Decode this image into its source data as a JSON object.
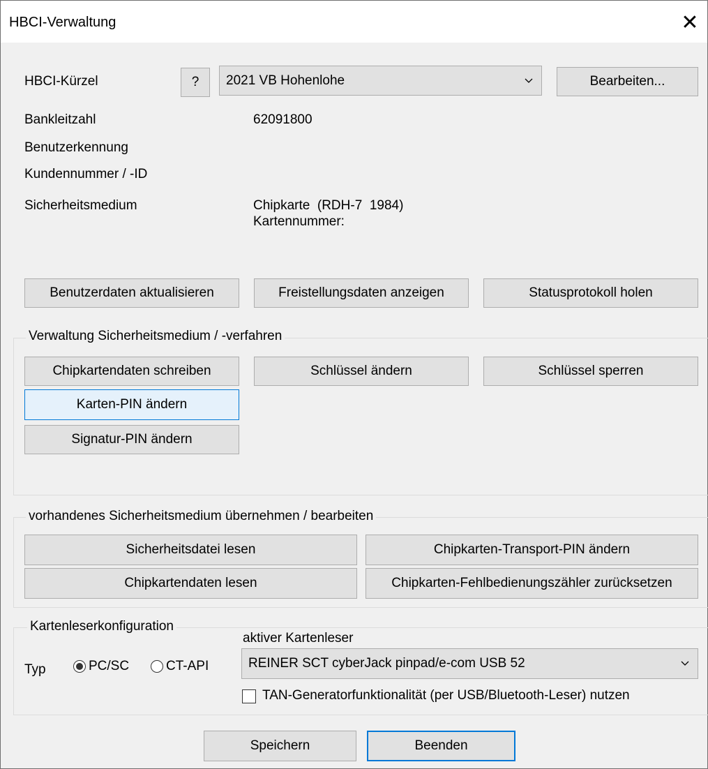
{
  "window": {
    "title": "HBCI-Verwaltung",
    "close_symbol": "✕"
  },
  "bank": {
    "hbci_label": "HBCI-Kürzel",
    "help_label": "?",
    "hbci_value": "2021 VB Hohenlohe",
    "edit_label": "Bearbeiten...",
    "blz_label": "Bankleitzahl",
    "blz_value": "62091800",
    "user_label": "Benutzerkennung",
    "customer_label": "Kundennummer / -ID",
    "medium_label": "Sicherheitsmedium",
    "medium_value": "Chipkarte  (RDH-7  1984)",
    "card_number_label": "Kartennummer:",
    "buttons": {
      "update_user": "Benutzerdaten aktualisieren",
      "show_release": "Freistellungsdaten anzeigen",
      "fetch_status": "Statusprotokoll holen"
    }
  },
  "security_admin": {
    "title": "Verwaltung Sicherheitsmedium / -verfahren",
    "buttons": {
      "write_chip": "Chipkartendaten schreiben",
      "change_key": "Schlüssel ändern",
      "lock_key": "Schlüssel sperren",
      "change_card_pin": "Karten-PIN ändern",
      "change_sig_pin": "Signatur-PIN ändern"
    }
  },
  "existing_medium": {
    "title": "vorhandenes Sicherheitsmedium übernehmen / bearbeiten",
    "buttons": {
      "read_file": "Sicherheitsdatei lesen",
      "change_transport_pin": "Chipkarten-Transport-PIN ändern",
      "read_chip": "Chipkartendaten lesen",
      "reset_counter": "Chipkarten-Fehlbedienungszähler zurücksetzen"
    }
  },
  "reader_config": {
    "title": "Kartenleserkonfiguration",
    "active_reader_label": "aktiver Kartenleser",
    "type_label": "Typ",
    "radio_pcsc": "PC/SC",
    "radio_ctapi": "CT-API",
    "selected_type": "PC/SC",
    "reader_value": "REINER SCT cyberJack pinpad/e-com USB 52",
    "tan_checkbox_label": "TAN-Generatorfunktionalität (per USB/Bluetooth-Leser) nutzen",
    "tan_checked": false
  },
  "footer": {
    "save_label": "Speichern",
    "quit_label": "Beenden"
  },
  "colors": {
    "accent": "#0078d7",
    "dialog_bg": "#f0f0f0",
    "button_bg": "#e1e1e1"
  }
}
